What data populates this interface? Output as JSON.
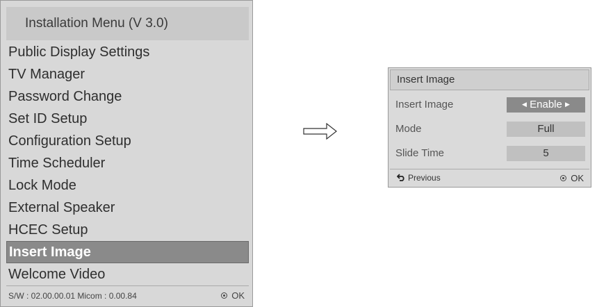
{
  "main_menu": {
    "title": "Installation Menu (V 3.0)",
    "items": [
      {
        "label": "Public Display Settings"
      },
      {
        "label": "TV Manager"
      },
      {
        "label": "Password Change"
      },
      {
        "label": "Set ID Setup"
      },
      {
        "label": "Configuration Setup"
      },
      {
        "label": "Time Scheduler"
      },
      {
        "label": "Lock Mode"
      },
      {
        "label": "External Speaker"
      },
      {
        "label": "HCEC Setup"
      },
      {
        "label": "Insert Image",
        "selected": true
      },
      {
        "label": "Welcome Video"
      }
    ],
    "footer": {
      "sw_info": "S/W : 02.00.00.01 Micom : 0.00.84",
      "ok_label": "OK",
      "ok_icon": "ok-button-icon"
    }
  },
  "arrow_icon": "right-arrow-icon",
  "sub_menu": {
    "title": "Insert Image",
    "rows": [
      {
        "label": "Insert Image",
        "value": "Enable",
        "active": true
      },
      {
        "label": "Mode",
        "value": "Full"
      },
      {
        "label": "Slide Time",
        "value": "5"
      }
    ],
    "footer": {
      "previous_label": "Previous",
      "previous_icon": "return-arrow-icon",
      "ok_label": "OK",
      "ok_icon": "ok-button-icon"
    }
  },
  "colors": {
    "menu_bg": "#d8d8d8",
    "selected_bg": "#8a8a8a",
    "value_bg": "#c0c0c0"
  }
}
